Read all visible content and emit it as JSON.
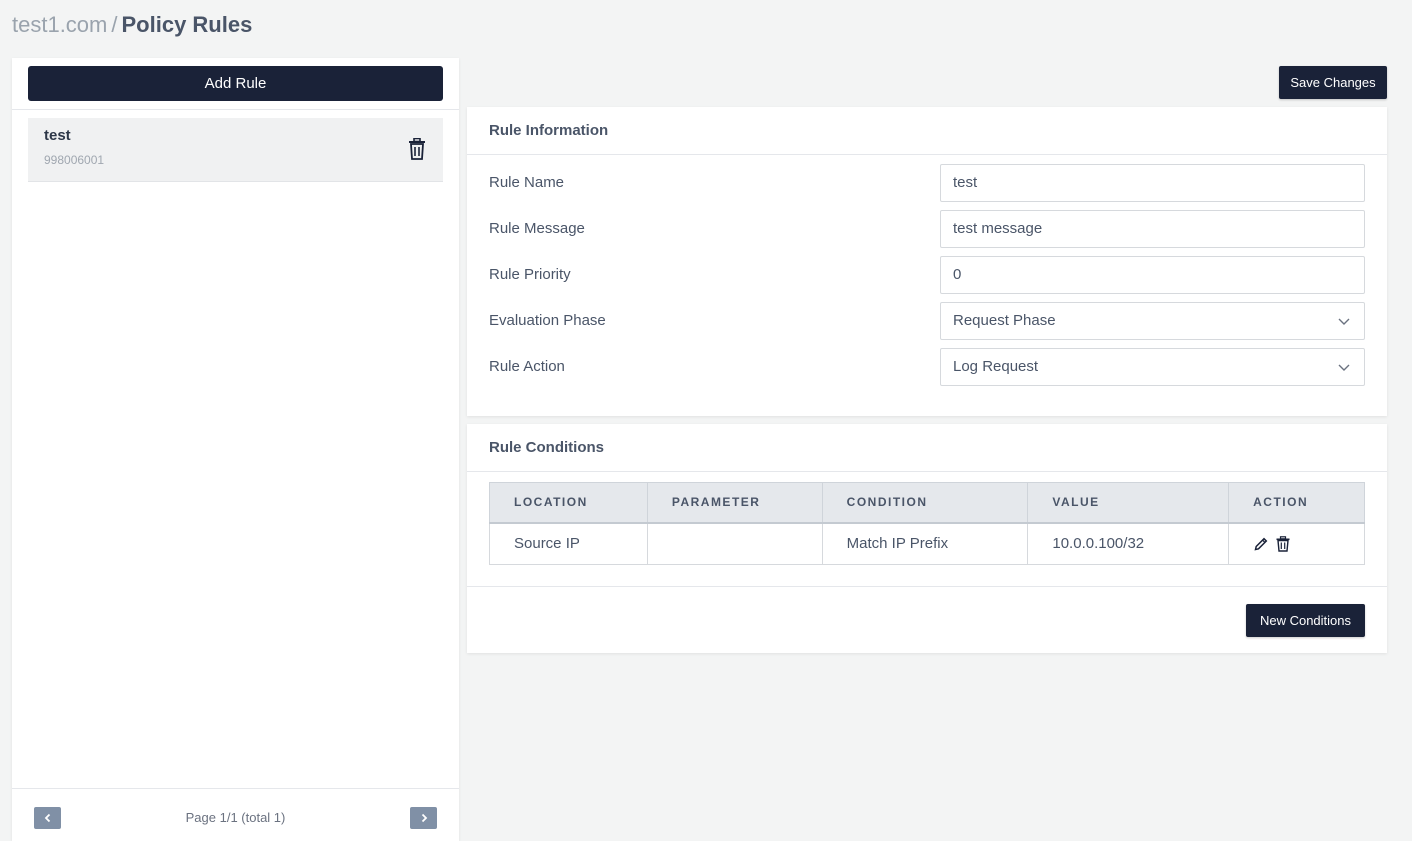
{
  "breadcrumb": {
    "domain": "test1.com",
    "separator": "/",
    "title": "Policy Rules"
  },
  "sidebar": {
    "add_rule_label": "Add Rule",
    "rules": [
      {
        "name": "test",
        "id": "998006001",
        "delete_icon": "trash-icon"
      }
    ],
    "pagination": {
      "text": "Page 1/1 (total 1)",
      "prev_icon": "chevron-left-icon",
      "next_icon": "chevron-right-icon"
    }
  },
  "toolbar": {
    "save_label": "Save Changes"
  },
  "rule_info": {
    "title": "Rule Information",
    "fields": [
      {
        "label": "Rule Name",
        "value": "test",
        "type": "text"
      },
      {
        "label": "Rule Message",
        "value": "test message",
        "type": "text"
      },
      {
        "label": "Rule Priority",
        "value": "0",
        "type": "text"
      },
      {
        "label": "Evaluation Phase",
        "value": "Request Phase",
        "type": "select"
      },
      {
        "label": "Rule Action",
        "value": "Log Request",
        "type": "select"
      }
    ]
  },
  "conditions": {
    "title": "Rule Conditions",
    "columns": [
      "LOCATION",
      "PARAMETER",
      "CONDITION",
      "VALUE",
      "ACTION"
    ],
    "rows": [
      {
        "location": "Source IP",
        "parameter": "",
        "condition": "Match IP Prefix",
        "value": "10.0.0.100/32",
        "actions": [
          "pencil-icon",
          "trash-icon"
        ]
      }
    ],
    "new_label": "New Conditions"
  },
  "colors": {
    "primary": "#1a2238",
    "background": "#f3f4f4",
    "pager": "#8090a6"
  }
}
